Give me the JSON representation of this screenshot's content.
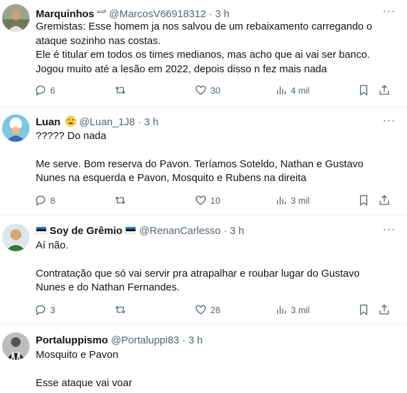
{
  "colors": {
    "text": "#0f1419",
    "muted": "#536471",
    "border": "#eff3f4"
  },
  "tweets": [
    {
      "name": "Marquinhos",
      "name_suffix": "ˢᶜᶜᴾ",
      "handle": "@MarcosV66918312",
      "time": "3 h",
      "lines": [
        "Gremistas: Esse homem ja nos salvou de um rebaixamento carregando o",
        "ataque sozinho nas costas.",
        "Ele é titular em todos os times medianos, mas acho que ai vai ser banco.",
        "Jogou muito até a lesão em 2022, depois disso n fez mais nada"
      ],
      "replies": "6",
      "retweets": "",
      "likes": "30",
      "views": "4 mil"
    },
    {
      "name": "Luan",
      "handle": "@Luan_1J8",
      "time": "3 h",
      "lines": [
        "????? Do nada",
        "",
        "Me serve. Bom reserva do Pavon. Teríamos Soteldo, Nathan e Gustavo",
        "Nunes na esquerda e Pavon, Mosquito e Rubens na direita"
      ],
      "replies": "8",
      "retweets": "",
      "likes": "10",
      "views": "3 mil"
    },
    {
      "name": "Soy de Grêmio",
      "handle": "@RenanCarlesso",
      "time": "3 h",
      "lines": [
        "Aí não.",
        "",
        "Contratação que só vai servir pra atrapalhar e roubar lugar do Gustavo",
        "Nunes e do Nathan Fernandes."
      ],
      "replies": "3",
      "retweets": "",
      "likes": "28",
      "views": "3 mil"
    },
    {
      "name": "Portaluppismo",
      "handle": "@Portaluppi83",
      "time": "3 h",
      "lines": [
        "Mosquito e Pavon",
        "",
        "Esse ataque vai voar"
      ]
    }
  ],
  "separator": "·",
  "more_glyph": "···"
}
